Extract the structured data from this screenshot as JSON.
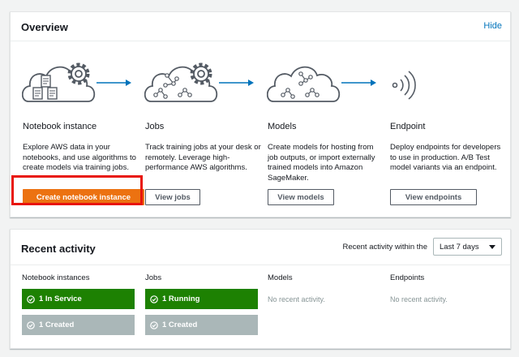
{
  "overview": {
    "title": "Overview",
    "hide_label": "Hide",
    "steps": [
      {
        "title": "Notebook instance",
        "description": "Explore AWS data in your notebooks, and use algorithms to create models via training jobs.",
        "button_label": "Create notebook instance",
        "icon": "cloud-notebook-gear-icon"
      },
      {
        "title": "Jobs",
        "description": "Track training jobs at your desk or remotely. Leverage high-performance AWS algorithms.",
        "button_label": "View jobs",
        "icon": "cloud-jobs-gear-icon"
      },
      {
        "title": "Models",
        "description": "Create models for hosting from job outputs, or import externally trained models into Amazon SageMaker.",
        "button_label": "View models",
        "icon": "cloud-models-icon"
      },
      {
        "title": "Endpoint",
        "description": "Deploy endpoints for developers to use in production. A/B Test model variants via an endpoint.",
        "button_label": "View endpoints",
        "icon": "endpoint-broadcast-icon"
      }
    ]
  },
  "activity": {
    "title": "Recent activity",
    "range_label": "Recent activity within the",
    "range_value": "Last 7 days",
    "columns": [
      {
        "header": "Notebook instances",
        "in_service": "1 In Service",
        "created": "1 Created"
      },
      {
        "header": "Jobs",
        "running": "1 Running",
        "created": "1 Created"
      },
      {
        "header": "Models",
        "empty": "No recent activity."
      },
      {
        "header": "Endpoints",
        "empty": "No recent activity."
      }
    ]
  },
  "colors": {
    "primary_button": "#ec7211",
    "link": "#0073bb",
    "status_green": "#1d8102",
    "status_gray": "#aab7b8",
    "highlight": "#e8140b"
  }
}
